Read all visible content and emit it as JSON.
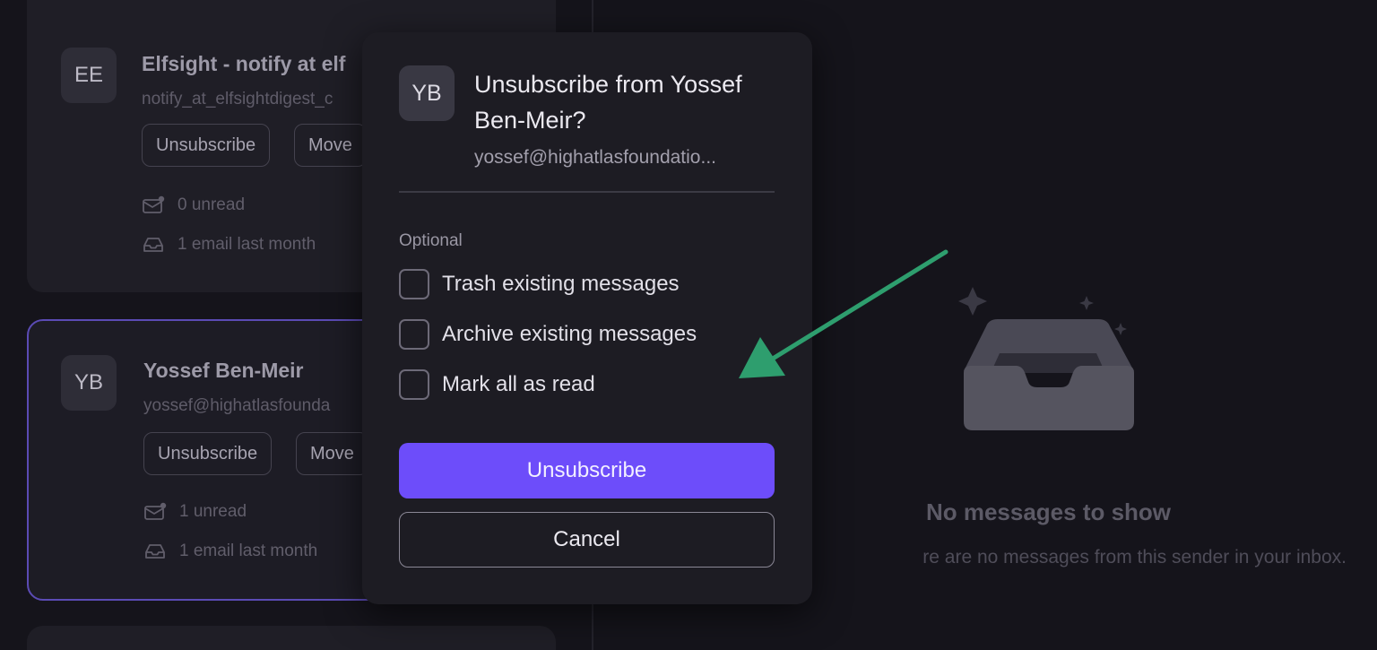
{
  "senders": [
    {
      "initials": "EE",
      "name": "Elfsight - notify at elf",
      "email": "notify_at_elfsightdigest_c",
      "unsubscribe_label": "Unsubscribe",
      "move_label": "Move",
      "unread": "0 unread",
      "volume": "1 email last month",
      "selected": false
    },
    {
      "initials": "YB",
      "name": "Yossef Ben-Meir",
      "email": "yossef@highatlasfounda",
      "unsubscribe_label": "Unsubscribe",
      "move_label": "Move",
      "unread": "1 unread",
      "volume": "1 email last month",
      "selected": true
    }
  ],
  "empty_state": {
    "title": "No messages to show",
    "subtitle": "re are no messages from this sender in your inbox."
  },
  "modal": {
    "avatar_initials": "YB",
    "title": "Unsubscribe from Yossef Ben-Meir?",
    "email": "yossef@highatlasfoundatio...",
    "optional_label": "Optional",
    "options": [
      {
        "label": "Trash existing messages",
        "checked": false
      },
      {
        "label": "Archive existing messages",
        "checked": false
      },
      {
        "label": "Mark all as read",
        "checked": false
      }
    ],
    "confirm_label": "Unsubscribe",
    "cancel_label": "Cancel"
  },
  "colors": {
    "background": "#15141b",
    "card": "#1f1e26",
    "accent": "#6d4dfa",
    "selected_border": "#5b4bb5",
    "annotation_arrow": "#2e9e6e"
  },
  "icons": {
    "unread": "mail-badge-icon",
    "volume": "inbox-tray-icon",
    "empty": "empty-inbox-icon",
    "annotation": "green-arrow"
  }
}
